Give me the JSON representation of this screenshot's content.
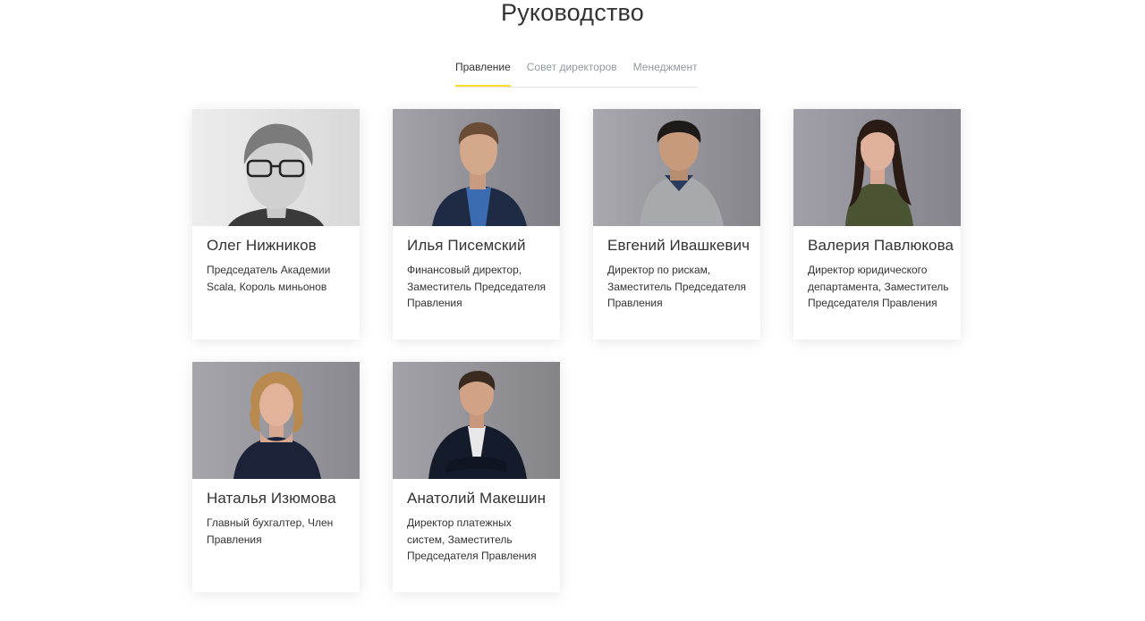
{
  "page": {
    "title": "Руководство"
  },
  "tabs": [
    {
      "label": "Правление",
      "active": true
    },
    {
      "label": "Совет директоров",
      "active": false
    },
    {
      "label": "Менеджмент",
      "active": false
    }
  ],
  "people": [
    {
      "name": "Олег Нижников",
      "role": "Председатель Академии Scala, Король миньонов"
    },
    {
      "name": "Илья Писемский",
      "role": "Финансовый директор, Заместитель Председателя Правления"
    },
    {
      "name": "Евгений Ивашкевич",
      "role": "Директор по рискам, Заместитель Председателя Правления"
    },
    {
      "name": "Валерия Павлюкова",
      "role": "Директор юридического департамента, Заместитель Председателя Правления"
    },
    {
      "name": "Наталья Изюмова",
      "role": "Главный бухгалтер, Член Правления"
    },
    {
      "name": "Анатолий Макешин",
      "role": "Директор платежных систем, Заместитель Председателя Правления"
    }
  ],
  "colors": {
    "accent": "#ffdd2d",
    "text": "#333333",
    "muted": "#9299a2",
    "photo_background": "#8d8b92"
  }
}
